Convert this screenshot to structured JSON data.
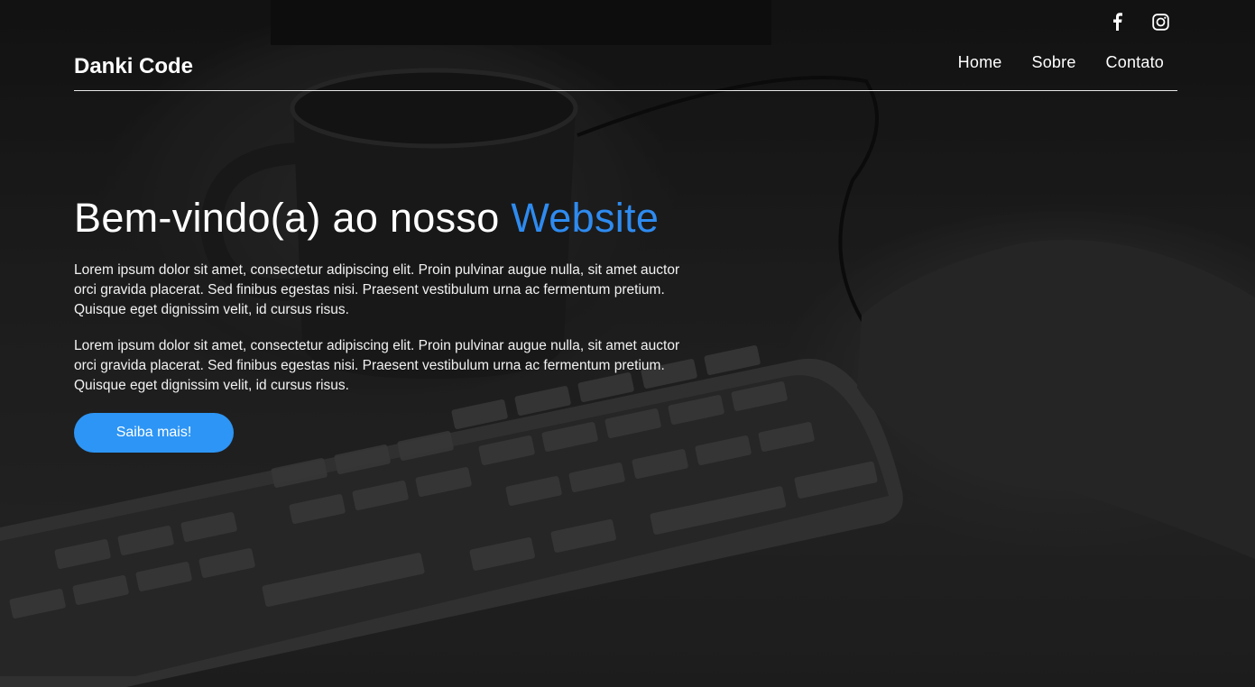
{
  "social": {
    "facebook_icon": "facebook-icon",
    "instagram_icon": "instagram-icon"
  },
  "header": {
    "logo": "Danki Code",
    "nav": [
      {
        "label": "Home"
      },
      {
        "label": "Sobre"
      },
      {
        "label": "Contato"
      }
    ]
  },
  "hero": {
    "title_prefix": "Bem-vindo(a) ao nosso ",
    "title_accent": "Website",
    "paragraphs": [
      "Lorem ipsum dolor sit amet, consectetur adipiscing elit. Proin pulvinar augue nulla, sit amet auctor orci gravida placerat. Sed finibus egestas nisi. Praesent vestibulum urna ac fermentum pretium. Quisque eget dignissim velit, id cursus risus.",
      "Lorem ipsum dolor sit amet, consectetur adipiscing elit. Proin pulvinar augue nulla, sit amet auctor orci gravida placerat. Sed finibus egestas nisi. Praesent vestibulum urna ac fermentum pretium. Quisque eget dignissim velit, id cursus risus."
    ],
    "button_label": "Saiba mais!"
  },
  "colors": {
    "accent": "#2e8bf0",
    "button": "#2d95f5"
  }
}
